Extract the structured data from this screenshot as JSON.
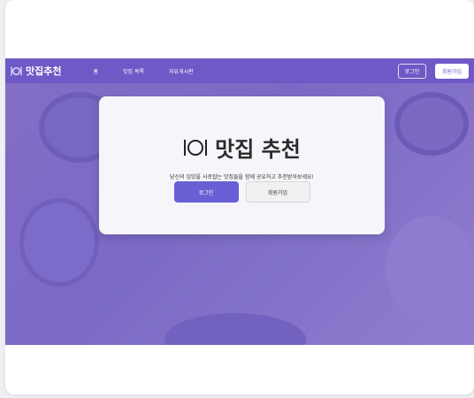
{
  "nav": {
    "brand": "맛집추천",
    "links": [
      "홈",
      "맛집 목록",
      "자유게시판"
    ],
    "login": "로그인",
    "signup": "회원가입"
  },
  "hero_card": {
    "title": "맛집 추천",
    "subtitle": "당신의 입맛을 사로잡는 맛집들을 함께 공유하고 추천받아보세요!",
    "login": "로그인",
    "signup": "회원가입"
  },
  "icons": {
    "brand": "plate-utensils-icon"
  },
  "colors": {
    "nav_bg": "#6f59c6",
    "accent": "#6b5fd6"
  }
}
